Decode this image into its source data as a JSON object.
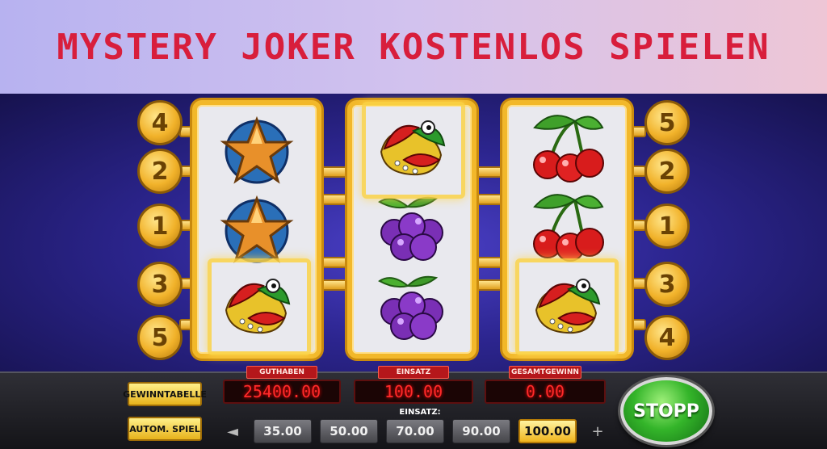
{
  "banner": {
    "title": "MYSTERY JOKER KOSTENLOS SPIELEN"
  },
  "paylines": {
    "left": [
      "4",
      "2",
      "1",
      "3",
      "5"
    ],
    "right": [
      "5",
      "2",
      "1",
      "3",
      "4"
    ]
  },
  "reels": [
    {
      "symbols": [
        "star-icon",
        "star-icon",
        "joker-icon"
      ],
      "highlighted": [
        false,
        false,
        true
      ]
    },
    {
      "symbols": [
        "joker-icon",
        "plum-icon",
        "plum-icon"
      ],
      "highlighted": [
        true,
        false,
        false
      ]
    },
    {
      "symbols": [
        "cherry-icon",
        "cherry-icon",
        "joker-icon"
      ],
      "highlighted": [
        false,
        false,
        true
      ]
    }
  ],
  "controls": {
    "paytable_label": "GEWINNTABELLE",
    "autoplay_label": "AUTOM. SPIEL",
    "stop_label": "STOPP",
    "stake_caption": "EINSATZ:",
    "stakes": [
      "35.00",
      "50.00",
      "70.00",
      "90.00",
      "100.00"
    ],
    "selected_stake": "100.00",
    "prev_symbol": "◄",
    "next_symbol": "+"
  },
  "meters": {
    "balance": {
      "label": "GUTHABEN",
      "value": "25400.00"
    },
    "bet": {
      "label": "EINSATZ",
      "value": "100.00"
    },
    "win": {
      "label": "GESAMTGEWINN",
      "value": "0.00"
    }
  },
  "colors": {
    "banner_text": "#d81e3c",
    "frame_gold": "#f2b82a",
    "meter_red": "#ff2a2a",
    "stop_green": "#34b52a"
  }
}
